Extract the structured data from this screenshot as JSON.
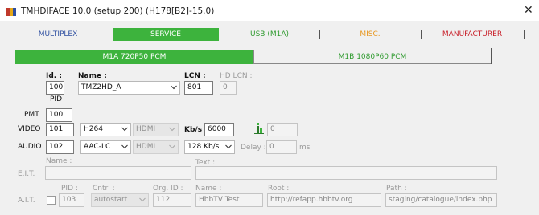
{
  "window": {
    "title": "TMHDIFACE 10.0 (setup 200) (H178[B2]-15.0)",
    "close_glyph": "✕"
  },
  "main_tabs": [
    {
      "label": "MULTIPLEX",
      "color": "#2e4fa0",
      "selected": false
    },
    {
      "label": "SERVICE",
      "color": "#ffffff",
      "selected": true
    },
    {
      "label": "USB (M1A)",
      "color": "#2e9a2e",
      "selected": false
    },
    {
      "label": "MISC.",
      "color": "#e8961c",
      "selected": false
    },
    {
      "label": "MANUFACTURER",
      "color": "#c8202a",
      "selected": false
    }
  ],
  "sub_tabs": [
    {
      "label": "M1A 720P50 PCM",
      "selected": true
    },
    {
      "label": "M1B 1080P60 PCM",
      "selected": false
    }
  ],
  "colors": {
    "accent_green": "#3db33d",
    "selected_tab_text": "#ffffff"
  },
  "service": {
    "id_label": "Id. :",
    "id_value": "100",
    "name_label": "Name :",
    "name_value": "TMZ2HD_A",
    "lcn_label": "LCN :",
    "lcn_value": "801",
    "hd_lcn_label": "HD LCN :",
    "hd_lcn_value": "0",
    "pid_label": "PID"
  },
  "pmt": {
    "label": "PMT",
    "value": "100"
  },
  "video": {
    "label": "VIDEO",
    "pid": "101",
    "codec": "H264",
    "interface": "HDMI",
    "kbs_label": "Kb/s :",
    "kbs_value": "6000",
    "extra_value": "0",
    "extra_icon": "info-bar-icon"
  },
  "audio": {
    "label": "AUDIO",
    "pid": "102",
    "codec": "AAC-LC",
    "interface": "HDMI",
    "bitrate": "128 Kb/s",
    "delay_label": "Delay :",
    "delay_value": "0",
    "delay_unit": "ms"
  },
  "eit": {
    "label": "E.I.T.",
    "name_label": "Name :",
    "name_value": "",
    "text_label": "Text :",
    "text_value": ""
  },
  "ait": {
    "label": "A.I.T.",
    "pid_label": "PID :",
    "pid_value": "103",
    "cntrl_label": "Cntrl :",
    "cntrl_value": "autostart",
    "org_id_label": "Org. ID :",
    "org_id_value": "112",
    "name_label": "Name :",
    "name_value": "HbbTV Test",
    "root_label": "Root :",
    "root_value": "http://refapp.hbbtv.org",
    "path_label": "Path :",
    "path_value": "staging/catalogue/index.php"
  }
}
